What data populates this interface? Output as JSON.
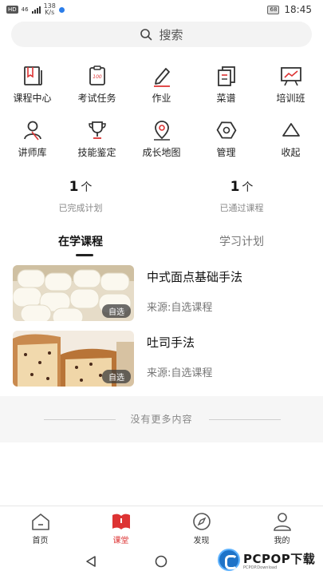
{
  "status_bar": {
    "sig1": "HD",
    "sig2": "46",
    "netspeed_value": "138",
    "netspeed_unit": "K/s",
    "battery": "68",
    "time": "18:45"
  },
  "search": {
    "placeholder": "搜索"
  },
  "grid": [
    {
      "label": "课程中心",
      "icon": "book-icon"
    },
    {
      "label": "考试任务",
      "icon": "exam-icon"
    },
    {
      "label": "作业",
      "icon": "pencil-icon"
    },
    {
      "label": "菜谱",
      "icon": "recipe-icon"
    },
    {
      "label": "培训班",
      "icon": "board-icon"
    },
    {
      "label": "讲师库",
      "icon": "lecturer-icon"
    },
    {
      "label": "技能鉴定",
      "icon": "trophy-icon"
    },
    {
      "label": "成长地图",
      "icon": "map-pin-icon"
    },
    {
      "label": "管理",
      "icon": "hexagon-icon"
    },
    {
      "label": "收起",
      "icon": "triangle-up-icon"
    }
  ],
  "stats": [
    {
      "value": "1",
      "unit": "个",
      "label": "已完成计划"
    },
    {
      "value": "1",
      "unit": "个",
      "label": "已通过课程"
    }
  ],
  "tabs": [
    {
      "label": "在学课程",
      "active": true
    },
    {
      "label": "学习计划",
      "active": false
    }
  ],
  "courses": [
    {
      "title": "中式面点基础手法",
      "source": "来源:自选课程",
      "badge": "自选"
    },
    {
      "title": "吐司手法",
      "source": "来源:自选课程",
      "badge": "自选"
    }
  ],
  "no_more": "没有更多内容",
  "bottom_nav": [
    {
      "label": "首页",
      "icon": "home-icon",
      "active": false
    },
    {
      "label": "课堂",
      "icon": "classroom-icon",
      "active": true
    },
    {
      "label": "发现",
      "icon": "compass-icon",
      "active": false
    },
    {
      "label": "我的",
      "icon": "profile-icon",
      "active": false
    }
  ],
  "colors": {
    "accent": "#d33333",
    "text": "#222222",
    "muted": "#888888"
  },
  "watermark": {
    "brand": "PCPOP下载",
    "sub": "PCPOP.Download"
  }
}
